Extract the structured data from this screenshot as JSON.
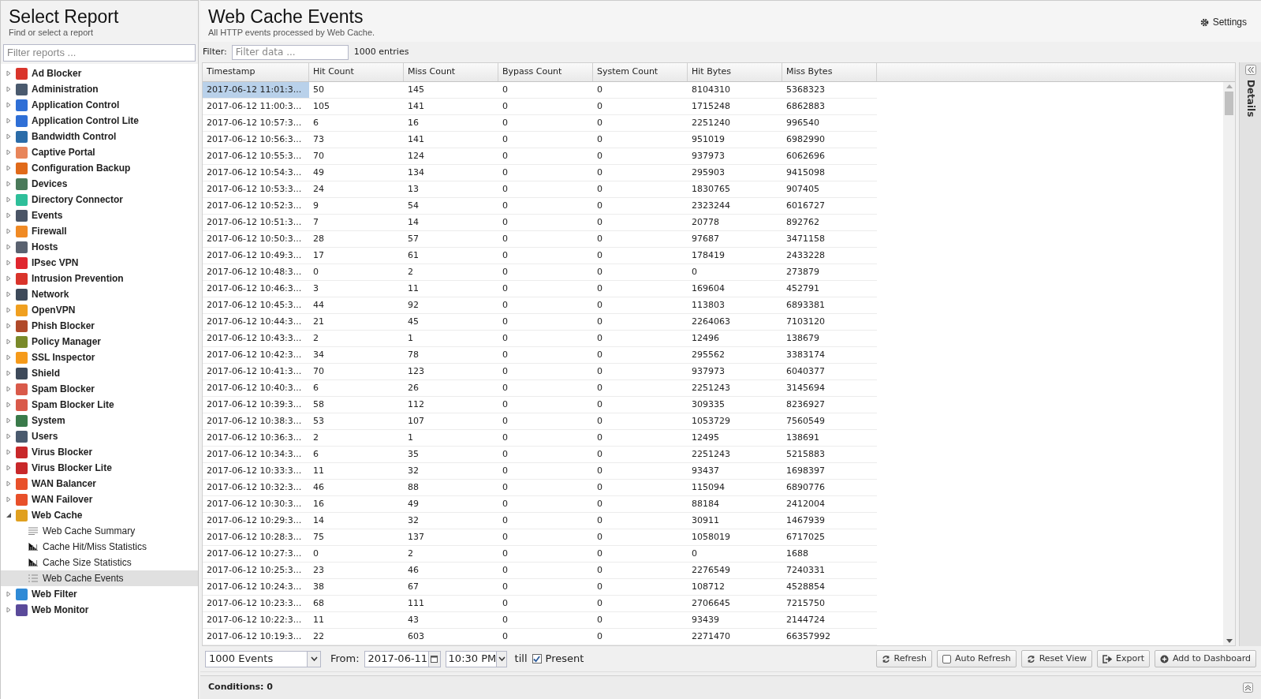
{
  "sidebar": {
    "title": "Select Report",
    "subtitle": "Find or select a report",
    "filter": {
      "placeholder": "Filter reports ..."
    },
    "items": [
      {
        "label": "Ad Blocker",
        "color": "#d9342b",
        "expanded": false
      },
      {
        "label": "Administration",
        "color": "#4a5a6e",
        "expanded": false
      },
      {
        "label": "Application Control",
        "color": "#2f6fd6",
        "expanded": false
      },
      {
        "label": "Application Control Lite",
        "color": "#2f6fd6",
        "expanded": false
      },
      {
        "label": "Bandwidth Control",
        "color": "#2b6ca8",
        "expanded": false
      },
      {
        "label": "Captive Portal",
        "color": "#e8855a",
        "expanded": false
      },
      {
        "label": "Configuration Backup",
        "color": "#e06a1a",
        "expanded": false
      },
      {
        "label": "Devices",
        "color": "#4a7a5a",
        "expanded": false
      },
      {
        "label": "Directory Connector",
        "color": "#2ebf9a",
        "expanded": false
      },
      {
        "label": "Events",
        "color": "#4a5566",
        "expanded": false
      },
      {
        "label": "Firewall",
        "color": "#f08a24",
        "expanded": false
      },
      {
        "label": "Hosts",
        "color": "#5a6270",
        "expanded": false
      },
      {
        "label": "IPsec VPN",
        "color": "#e0262e",
        "expanded": false
      },
      {
        "label": "Intrusion Prevention",
        "color": "#d9342b",
        "expanded": false
      },
      {
        "label": "Network",
        "color": "#3e4a5a",
        "expanded": false
      },
      {
        "label": "OpenVPN",
        "color": "#f0a020",
        "expanded": false
      },
      {
        "label": "Phish Blocker",
        "color": "#b04a2a",
        "expanded": false
      },
      {
        "label": "Policy Manager",
        "color": "#7a8a2a",
        "expanded": false
      },
      {
        "label": "SSL Inspector",
        "color": "#f59a1a",
        "expanded": false
      },
      {
        "label": "Shield",
        "color": "#3e4a5a",
        "expanded": false
      },
      {
        "label": "Spam Blocker",
        "color": "#d95a4a",
        "expanded": false
      },
      {
        "label": "Spam Blocker Lite",
        "color": "#d95a4a",
        "expanded": false
      },
      {
        "label": "System",
        "color": "#3a7a4a",
        "expanded": false
      },
      {
        "label": "Users",
        "color": "#4a5a6e",
        "expanded": false
      },
      {
        "label": "Virus Blocker",
        "color": "#c8282a",
        "expanded": false
      },
      {
        "label": "Virus Blocker Lite",
        "color": "#c8282a",
        "expanded": false
      },
      {
        "label": "WAN Balancer",
        "color": "#e8502a",
        "expanded": false
      },
      {
        "label": "WAN Failover",
        "color": "#e8502a",
        "expanded": false
      },
      {
        "label": "Web Cache",
        "color": "#e0a020",
        "expanded": true,
        "children": [
          {
            "label": "Web Cache Summary",
            "kind": "text",
            "selected": false
          },
          {
            "label": "Cache Hit/Miss Statistics",
            "kind": "chart",
            "selected": false
          },
          {
            "label": "Cache Size Statistics",
            "kind": "chart",
            "selected": false
          },
          {
            "label": "Web Cache Events",
            "kind": "events",
            "selected": true
          }
        ]
      },
      {
        "label": "Web Filter",
        "color": "#2f8ad6",
        "expanded": false
      },
      {
        "label": "Web Monitor",
        "color": "#5a4a9a",
        "expanded": false
      }
    ]
  },
  "header": {
    "title": "Web Cache Events",
    "subtitle": "All HTTP events processed by Web Cache.",
    "settings": "Settings"
  },
  "filter_bar": {
    "label": "Filter:",
    "placeholder": "Filter data ...",
    "count": "1000 entries"
  },
  "table": {
    "columns": [
      "Timestamp",
      "Hit Count",
      "Miss Count",
      "Bypass Count",
      "System Count",
      "Hit Bytes",
      "Miss Bytes"
    ],
    "rows": [
      {
        "selected": true,
        "cells": [
          "2017-06-12 11:01:3...",
          "50",
          "145",
          "0",
          "0",
          "8104310",
          "5368323"
        ]
      },
      {
        "selected": false,
        "cells": [
          "2017-06-12 11:00:3...",
          "105",
          "141",
          "0",
          "0",
          "1715248",
          "6862883"
        ]
      },
      {
        "selected": false,
        "cells": [
          "2017-06-12 10:57:3...",
          "6",
          "16",
          "0",
          "0",
          "2251240",
          "996540"
        ]
      },
      {
        "selected": false,
        "cells": [
          "2017-06-12 10:56:3...",
          "73",
          "141",
          "0",
          "0",
          "951019",
          "6982990"
        ]
      },
      {
        "selected": false,
        "cells": [
          "2017-06-12 10:55:3...",
          "70",
          "124",
          "0",
          "0",
          "937973",
          "6062696"
        ]
      },
      {
        "selected": false,
        "cells": [
          "2017-06-12 10:54:3...",
          "49",
          "134",
          "0",
          "0",
          "295903",
          "9415098"
        ]
      },
      {
        "selected": false,
        "cells": [
          "2017-06-12 10:53:3...",
          "24",
          "13",
          "0",
          "0",
          "1830765",
          "907405"
        ]
      },
      {
        "selected": false,
        "cells": [
          "2017-06-12 10:52:3...",
          "9",
          "54",
          "0",
          "0",
          "2323244",
          "6016727"
        ]
      },
      {
        "selected": false,
        "cells": [
          "2017-06-12 10:51:3...",
          "7",
          "14",
          "0",
          "0",
          "20778",
          "892762"
        ]
      },
      {
        "selected": false,
        "cells": [
          "2017-06-12 10:50:3...",
          "28",
          "57",
          "0",
          "0",
          "97687",
          "3471158"
        ]
      },
      {
        "selected": false,
        "cells": [
          "2017-06-12 10:49:3...",
          "17",
          "61",
          "0",
          "0",
          "178419",
          "2433228"
        ]
      },
      {
        "selected": false,
        "cells": [
          "2017-06-12 10:48:3...",
          "0",
          "2",
          "0",
          "0",
          "0",
          "273879"
        ]
      },
      {
        "selected": false,
        "cells": [
          "2017-06-12 10:46:3...",
          "3",
          "11",
          "0",
          "0",
          "169604",
          "452791"
        ]
      },
      {
        "selected": false,
        "cells": [
          "2017-06-12 10:45:3...",
          "44",
          "92",
          "0",
          "0",
          "113803",
          "6893381"
        ]
      },
      {
        "selected": false,
        "cells": [
          "2017-06-12 10:44:3...",
          "21",
          "45",
          "0",
          "0",
          "2264063",
          "7103120"
        ]
      },
      {
        "selected": false,
        "cells": [
          "2017-06-12 10:43:3...",
          "2",
          "1",
          "0",
          "0",
          "12496",
          "138679"
        ]
      },
      {
        "selected": false,
        "cells": [
          "2017-06-12 10:42:3...",
          "34",
          "78",
          "0",
          "0",
          "295562",
          "3383174"
        ]
      },
      {
        "selected": false,
        "cells": [
          "2017-06-12 10:41:3...",
          "70",
          "123",
          "0",
          "0",
          "937973",
          "6040377"
        ]
      },
      {
        "selected": false,
        "cells": [
          "2017-06-12 10:40:3...",
          "6",
          "26",
          "0",
          "0",
          "2251243",
          "3145694"
        ]
      },
      {
        "selected": false,
        "cells": [
          "2017-06-12 10:39:3...",
          "58",
          "112",
          "0",
          "0",
          "309335",
          "8236927"
        ]
      },
      {
        "selected": false,
        "cells": [
          "2017-06-12 10:38:3...",
          "53",
          "107",
          "0",
          "0",
          "1053729",
          "7560549"
        ]
      },
      {
        "selected": false,
        "cells": [
          "2017-06-12 10:36:3...",
          "2",
          "1",
          "0",
          "0",
          "12495",
          "138691"
        ]
      },
      {
        "selected": false,
        "cells": [
          "2017-06-12 10:34:3...",
          "6",
          "35",
          "0",
          "0",
          "2251243",
          "5215883"
        ]
      },
      {
        "selected": false,
        "cells": [
          "2017-06-12 10:33:3...",
          "11",
          "32",
          "0",
          "0",
          "93437",
          "1698397"
        ]
      },
      {
        "selected": false,
        "cells": [
          "2017-06-12 10:32:3...",
          "46",
          "88",
          "0",
          "0",
          "115094",
          "6890776"
        ]
      },
      {
        "selected": false,
        "cells": [
          "2017-06-12 10:30:3...",
          "16",
          "49",
          "0",
          "0",
          "88184",
          "2412004"
        ]
      },
      {
        "selected": false,
        "cells": [
          "2017-06-12 10:29:3...",
          "14",
          "32",
          "0",
          "0",
          "30911",
          "1467939"
        ]
      },
      {
        "selected": false,
        "cells": [
          "2017-06-12 10:28:3...",
          "75",
          "137",
          "0",
          "0",
          "1058019",
          "6717025"
        ]
      },
      {
        "selected": false,
        "cells": [
          "2017-06-12 10:27:3...",
          "0",
          "2",
          "0",
          "0",
          "0",
          "1688"
        ]
      },
      {
        "selected": false,
        "cells": [
          "2017-06-12 10:25:3...",
          "23",
          "46",
          "0",
          "0",
          "2276549",
          "7240331"
        ]
      },
      {
        "selected": false,
        "cells": [
          "2017-06-12 10:24:3...",
          "38",
          "67",
          "0",
          "0",
          "108712",
          "4528854"
        ]
      },
      {
        "selected": false,
        "cells": [
          "2017-06-12 10:23:3...",
          "68",
          "111",
          "0",
          "0",
          "2706645",
          "7215750"
        ]
      },
      {
        "selected": false,
        "cells": [
          "2017-06-12 10:22:3...",
          "11",
          "43",
          "0",
          "0",
          "93439",
          "2144724"
        ]
      },
      {
        "selected": false,
        "cells": [
          "2017-06-12 10:19:3...",
          "22",
          "603",
          "0",
          "0",
          "2271470",
          "66357992"
        ]
      }
    ]
  },
  "details_panel": {
    "label": "Details"
  },
  "toolbar": {
    "limit": "1000 Events",
    "from_label": "From:",
    "date": "2017-06-11",
    "time": "10:30 PM",
    "till": "till",
    "present": {
      "label": "Present",
      "checked": true
    },
    "buttons": [
      {
        "label": "Refresh",
        "kind": "refresh"
      },
      {
        "label": "Auto Refresh",
        "kind": "checkbox",
        "checked": false
      },
      {
        "label": "Reset View",
        "kind": "refresh"
      },
      {
        "label": "Export",
        "kind": "export"
      },
      {
        "label": "Add to Dashboard",
        "kind": "add"
      }
    ]
  },
  "conditions": {
    "label": "Conditions: 0"
  }
}
